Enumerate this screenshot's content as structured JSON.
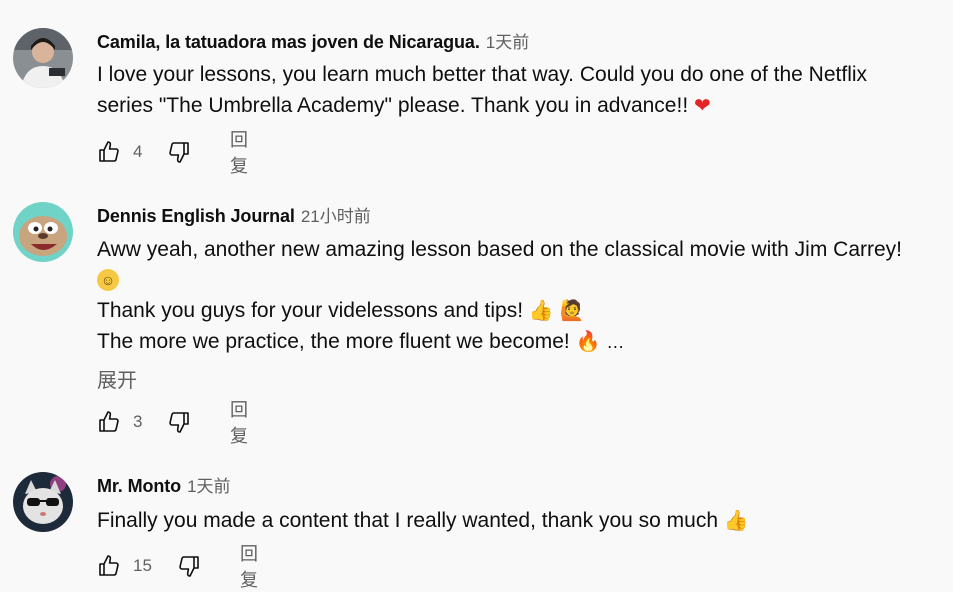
{
  "comments": [
    {
      "author": "Camila, la tatuadora mas joven de Nicaragua.",
      "time": "1天前",
      "lines": [
        "I love your lessons, you learn much better that way.  Could you do one of the Netflix",
        "series \"The Umbrella Academy\" please. Thank you in advance!!"
      ],
      "emoji": "❤",
      "likes": "4",
      "reply_label": "回复",
      "avatar_icon": "avatar-photo-tattoo-artist"
    },
    {
      "author": "Dennis English Journal",
      "time": "21小时前",
      "lines": [
        "Aww yeah, another new amazing lesson based on the classical movie with Jim Carrey!",
        "Thank you guys for your videlessons and tips!",
        "The more we practice, the more fluent we become!",
        "…"
      ],
      "expand_label": "展开",
      "likes": "3",
      "reply_label": "回复",
      "avatar_icon": "avatar-cartoon-sloth"
    },
    {
      "author": "Mr. Monto",
      "time": "1天前",
      "lines": [
        "Finally you made a content that I really wanted, thank you so much"
      ],
      "likes": "15",
      "reply_label": "回复",
      "avatar_icon": "avatar-cat-with-sunglasses"
    }
  ],
  "colors": {
    "background": "#f9f9f9",
    "text": "#0f0f0f",
    "secondary": "#606060"
  }
}
